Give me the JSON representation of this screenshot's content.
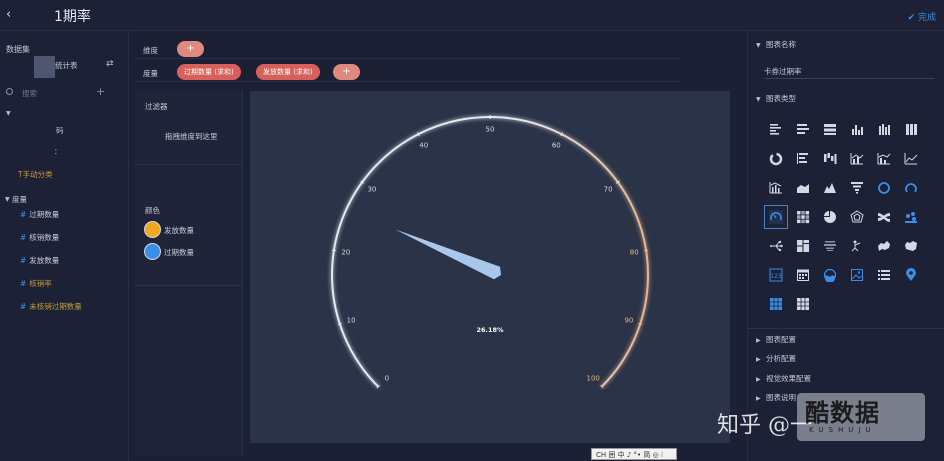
{
  "topbar": {
    "back_glyph": "‹",
    "title": "1期率",
    "done_label": "完成",
    "done_icon": "check-icon"
  },
  "left": {
    "dataset_label": "数据集",
    "dataset_name": "统计表",
    "search_placeholder": "搜索",
    "dimension_items": [
      "码",
      "："
    ],
    "manual_group": "手动分类",
    "measures_label": "度量",
    "measures": [
      {
        "name": "过期数量",
        "style": "normal"
      },
      {
        "name": "核销数量",
        "style": "normal"
      },
      {
        "name": "发放数量",
        "style": "normal"
      },
      {
        "name": "核销率",
        "style": "gold"
      },
      {
        "name": "未核销过期数量",
        "style": "gold"
      }
    ]
  },
  "fields": {
    "dimension_label": "维度",
    "measure_label": "度量",
    "measure_pills": [
      "过期数量 (求和)",
      "发放数量 (求和)"
    ],
    "add_glyph": "+"
  },
  "filter": {
    "title": "过滤器",
    "drop_hint": "拖拽维度到这里",
    "color_title": "颜色",
    "legend": [
      {
        "label": "发放数量",
        "color": "#f0a81e"
      },
      {
        "label": "过期数量",
        "color": "#3b8ee8"
      }
    ]
  },
  "chart_data": {
    "type": "gauge",
    "min": 0,
    "max": 100,
    "ticks": [
      0,
      10,
      20,
      30,
      40,
      50,
      60,
      70,
      80,
      90,
      100
    ],
    "value": 26.18,
    "value_label": "26.18%",
    "colors": {
      "arc_light": "#e4e8f0",
      "arc_warm": "#e8b48c",
      "pointer": "#a9c7ea"
    }
  },
  "right": {
    "chart_name_section": "图表名称",
    "chart_name_value": "卡券过期率",
    "chart_type_section": "图表类型",
    "sections": [
      "图表配置",
      "分析配置",
      "视觉效果配置",
      "图表说明"
    ],
    "chart_type_icons": [
      "bar-horizontal-icon",
      "bar-stacked-horizontal-icon",
      "bar-percent-horizontal-icon",
      "column-icon",
      "column-stacked-icon",
      "column-percent-icon",
      "pie-ring-icon",
      "bar-sorted-icon",
      "waterfall-icon",
      "line-column-icon",
      "area-column-icon",
      "line-icon",
      "dual-axis-icon",
      "area-icon",
      "mountain-icon",
      "funnel-icon",
      "ring-icon",
      "progress-ring-icon",
      "gauge-icon",
      "heatmap-icon",
      "pie-icon",
      "radar-icon",
      "sankey-icon",
      "treemap-dots-icon",
      "scatter-flow-icon",
      "grid-icon",
      "word-cloud-icon",
      "org-chart-icon",
      "map-blue-icon",
      "map-white-icon",
      "number-card-icon",
      "calendar-icon",
      "liquid-icon",
      "image-icon",
      "list-icon",
      "location-pin-icon",
      "table-blue-icon",
      "table-icon"
    ],
    "selected_icon_index": 18
  },
  "ime": {
    "text": "CH 囲 中 ♪ °• 简 ◎ ⁝"
  },
  "watermark": {
    "zhihu": "知乎 @一",
    "brand": "酷数据",
    "brand_small": "KUSHUJU"
  }
}
